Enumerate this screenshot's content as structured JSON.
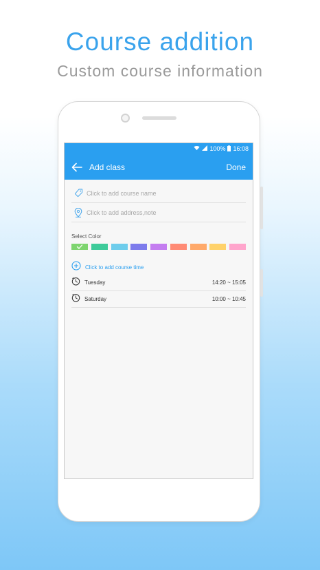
{
  "promo": {
    "title": "Course addition",
    "subtitle": "Custom course information"
  },
  "status_bar": {
    "battery": "100%",
    "time": "16:08"
  },
  "app_bar": {
    "title": "Add class",
    "done_label": "Done"
  },
  "form": {
    "course_name_placeholder": "Click to add course name",
    "address_placeholder": "Click to add address,note",
    "select_color_label": "Select Color",
    "colors": [
      "#7ed56f",
      "#3ecb9a",
      "#6ecdec",
      "#7d7bec",
      "#c47df0",
      "#ff8b75",
      "#ffa96a",
      "#ffd26a",
      "#ffa5cc"
    ],
    "selected_color_index": 0,
    "add_time_label": "Click to add course time"
  },
  "course_times": [
    {
      "day": "Tuesday",
      "range": "14:20 ~ 15:05"
    },
    {
      "day": "Saturday",
      "range": "10:00 ~ 10:45"
    }
  ],
  "accent_color": "#2a9ff0"
}
